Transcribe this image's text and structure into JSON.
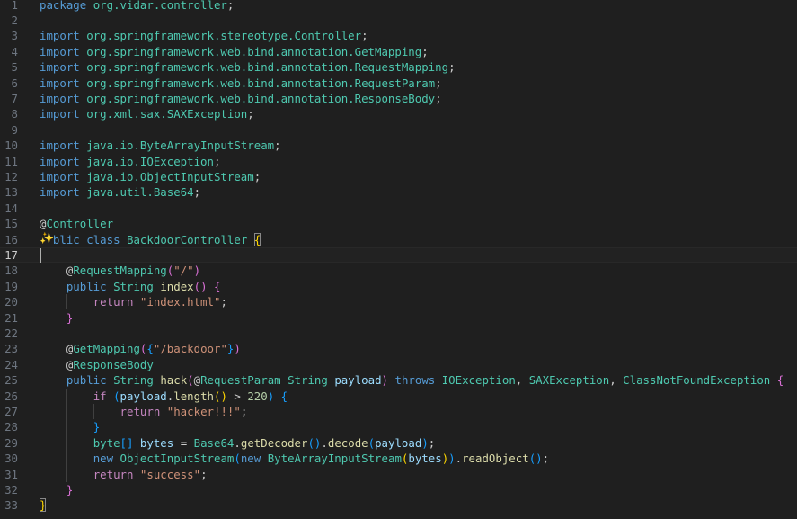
{
  "editor": {
    "active_line": 17,
    "icons": {
      "gutter_icon": "sparkle-icon"
    },
    "lines": [
      {
        "num": "1",
        "tokens": [
          [
            "k",
            "package"
          ],
          [
            "p",
            " "
          ],
          [
            "n",
            "org.vidar.controller"
          ],
          [
            "p",
            ";"
          ]
        ]
      },
      {
        "num": "2",
        "tokens": []
      },
      {
        "num": "3",
        "tokens": [
          [
            "k",
            "import"
          ],
          [
            "p",
            " "
          ],
          [
            "n",
            "org.springframework.stereotype.Controller"
          ],
          [
            "p",
            ";"
          ]
        ]
      },
      {
        "num": "4",
        "tokens": [
          [
            "k",
            "import"
          ],
          [
            "p",
            " "
          ],
          [
            "n",
            "org.springframework.web.bind.annotation.GetMapping"
          ],
          [
            "p",
            ";"
          ]
        ]
      },
      {
        "num": "5",
        "tokens": [
          [
            "k",
            "import"
          ],
          [
            "p",
            " "
          ],
          [
            "n",
            "org.springframework.web.bind.annotation.RequestMapping"
          ],
          [
            "p",
            ";"
          ]
        ]
      },
      {
        "num": "6",
        "tokens": [
          [
            "k",
            "import"
          ],
          [
            "p",
            " "
          ],
          [
            "n",
            "org.springframework.web.bind.annotation.RequestParam"
          ],
          [
            "p",
            ";"
          ]
        ]
      },
      {
        "num": "7",
        "tokens": [
          [
            "k",
            "import"
          ],
          [
            "p",
            " "
          ],
          [
            "n",
            "org.springframework.web.bind.annotation.ResponseBody"
          ],
          [
            "p",
            ";"
          ]
        ]
      },
      {
        "num": "8",
        "tokens": [
          [
            "k",
            "import"
          ],
          [
            "p",
            " "
          ],
          [
            "n",
            "org.xml.sax.SAXException"
          ],
          [
            "p",
            ";"
          ]
        ]
      },
      {
        "num": "9",
        "tokens": []
      },
      {
        "num": "10",
        "tokens": [
          [
            "k",
            "import"
          ],
          [
            "p",
            " "
          ],
          [
            "n",
            "java.io.ByteArrayInputStream"
          ],
          [
            "p",
            ";"
          ]
        ]
      },
      {
        "num": "11",
        "tokens": [
          [
            "k",
            "import"
          ],
          [
            "p",
            " "
          ],
          [
            "n",
            "java.io.IOException"
          ],
          [
            "p",
            ";"
          ]
        ]
      },
      {
        "num": "12",
        "tokens": [
          [
            "k",
            "import"
          ],
          [
            "p",
            " "
          ],
          [
            "n",
            "java.io.ObjectInputStream"
          ],
          [
            "p",
            ";"
          ]
        ]
      },
      {
        "num": "13",
        "tokens": [
          [
            "k",
            "import"
          ],
          [
            "p",
            " "
          ],
          [
            "n",
            "java.util.Base64"
          ],
          [
            "p",
            ";"
          ]
        ]
      },
      {
        "num": "14",
        "tokens": []
      },
      {
        "num": "15",
        "tokens": [
          [
            "p",
            "@"
          ],
          [
            "n",
            "Controller"
          ]
        ]
      },
      {
        "num": "16",
        "tokens": [
          [
            "p",
            "  "
          ],
          [
            "k",
            "blic"
          ],
          [
            "p",
            " "
          ],
          [
            "k",
            "class"
          ],
          [
            "p",
            " "
          ],
          [
            "n",
            "BackdoorController"
          ],
          [
            "p",
            " "
          ],
          [
            "b1m",
            "{"
          ]
        ]
      },
      {
        "num": "17",
        "tokens": []
      },
      {
        "num": "18",
        "tokens": [
          [
            "p",
            "    @"
          ],
          [
            "n",
            "RequestMapping"
          ],
          [
            "b2",
            "("
          ],
          [
            "s",
            "\"/\""
          ],
          [
            "b2",
            ")"
          ]
        ]
      },
      {
        "num": "19",
        "tokens": [
          [
            "p",
            "    "
          ],
          [
            "k",
            "public"
          ],
          [
            "p",
            " "
          ],
          [
            "n",
            "String"
          ],
          [
            "p",
            " "
          ],
          [
            "f",
            "index"
          ],
          [
            "b2",
            "()"
          ],
          [
            "p",
            " "
          ],
          [
            "b2",
            "{"
          ]
        ]
      },
      {
        "num": "20",
        "tokens": [
          [
            "p",
            "        "
          ],
          [
            "kc",
            "return"
          ],
          [
            "p",
            " "
          ],
          [
            "s",
            "\"index.html\""
          ],
          [
            "p",
            ";"
          ]
        ]
      },
      {
        "num": "21",
        "tokens": [
          [
            "p",
            "    "
          ],
          [
            "b2",
            "}"
          ]
        ]
      },
      {
        "num": "22",
        "tokens": []
      },
      {
        "num": "23",
        "tokens": [
          [
            "p",
            "    @"
          ],
          [
            "n",
            "GetMapping"
          ],
          [
            "b2",
            "("
          ],
          [
            "b3",
            "{"
          ],
          [
            "s",
            "\"/backdoor\""
          ],
          [
            "b3",
            "}"
          ],
          [
            "b2",
            ")"
          ]
        ]
      },
      {
        "num": "24",
        "tokens": [
          [
            "p",
            "    @"
          ],
          [
            "n",
            "ResponseBody"
          ]
        ]
      },
      {
        "num": "25",
        "tokens": [
          [
            "p",
            "    "
          ],
          [
            "k",
            "public"
          ],
          [
            "p",
            " "
          ],
          [
            "n",
            "String"
          ],
          [
            "p",
            " "
          ],
          [
            "f",
            "hack"
          ],
          [
            "b2",
            "("
          ],
          [
            "p",
            "@"
          ],
          [
            "n",
            "RequestParam"
          ],
          [
            "p",
            " "
          ],
          [
            "n",
            "String"
          ],
          [
            "p",
            " "
          ],
          [
            "v",
            "payload"
          ],
          [
            "b2",
            ")"
          ],
          [
            "p",
            " "
          ],
          [
            "k",
            "throws"
          ],
          [
            "p",
            " "
          ],
          [
            "n",
            "IOException"
          ],
          [
            "p",
            ", "
          ],
          [
            "n",
            "SAXException"
          ],
          [
            "p",
            ", "
          ],
          [
            "n",
            "ClassNotFoundException"
          ],
          [
            "p",
            " "
          ],
          [
            "b2",
            "{"
          ]
        ]
      },
      {
        "num": "26",
        "tokens": [
          [
            "p",
            "        "
          ],
          [
            "kc",
            "if"
          ],
          [
            "p",
            " "
          ],
          [
            "b3",
            "("
          ],
          [
            "v",
            "payload"
          ],
          [
            "p",
            "."
          ],
          [
            "f",
            "length"
          ],
          [
            "b1",
            "()"
          ],
          [
            "p",
            " > "
          ],
          [
            "m",
            "220"
          ],
          [
            "b3",
            ")"
          ],
          [
            "p",
            " "
          ],
          [
            "b3",
            "{"
          ]
        ]
      },
      {
        "num": "27",
        "tokens": [
          [
            "p",
            "            "
          ],
          [
            "kc",
            "return"
          ],
          [
            "p",
            " "
          ],
          [
            "s",
            "\"hacker!!!\""
          ],
          [
            "p",
            ";"
          ]
        ]
      },
      {
        "num": "28",
        "tokens": [
          [
            "p",
            "        "
          ],
          [
            "b3",
            "}"
          ]
        ]
      },
      {
        "num": "29",
        "tokens": [
          [
            "p",
            "        "
          ],
          [
            "n",
            "byte"
          ],
          [
            "b3",
            "[]"
          ],
          [
            "p",
            " "
          ],
          [
            "v",
            "bytes"
          ],
          [
            "p",
            " = "
          ],
          [
            "n",
            "Base64"
          ],
          [
            "p",
            "."
          ],
          [
            "f",
            "getDecoder"
          ],
          [
            "b3",
            "()"
          ],
          [
            "p",
            "."
          ],
          [
            "f",
            "decode"
          ],
          [
            "b3",
            "("
          ],
          [
            "v",
            "payload"
          ],
          [
            "b3",
            ")"
          ],
          [
            "p",
            ";"
          ]
        ]
      },
      {
        "num": "30",
        "tokens": [
          [
            "p",
            "        "
          ],
          [
            "k",
            "new"
          ],
          [
            "p",
            " "
          ],
          [
            "n",
            "ObjectInputStream"
          ],
          [
            "b3",
            "("
          ],
          [
            "k",
            "new"
          ],
          [
            "p",
            " "
          ],
          [
            "n",
            "ByteArrayInputStream"
          ],
          [
            "b1",
            "("
          ],
          [
            "v",
            "bytes"
          ],
          [
            "b1",
            ")"
          ],
          [
            "b3",
            ")"
          ],
          [
            "p",
            "."
          ],
          [
            "f",
            "readObject"
          ],
          [
            "b3",
            "()"
          ],
          [
            "p",
            ";"
          ]
        ]
      },
      {
        "num": "31",
        "tokens": [
          [
            "p",
            "        "
          ],
          [
            "kc",
            "return"
          ],
          [
            "p",
            " "
          ],
          [
            "s",
            "\"success\""
          ],
          [
            "p",
            ";"
          ]
        ]
      },
      {
        "num": "32",
        "tokens": [
          [
            "p",
            "    "
          ],
          [
            "b2",
            "}"
          ]
        ]
      },
      {
        "num": "33",
        "tokens": [
          [
            "b1m",
            "}"
          ]
        ]
      }
    ]
  }
}
